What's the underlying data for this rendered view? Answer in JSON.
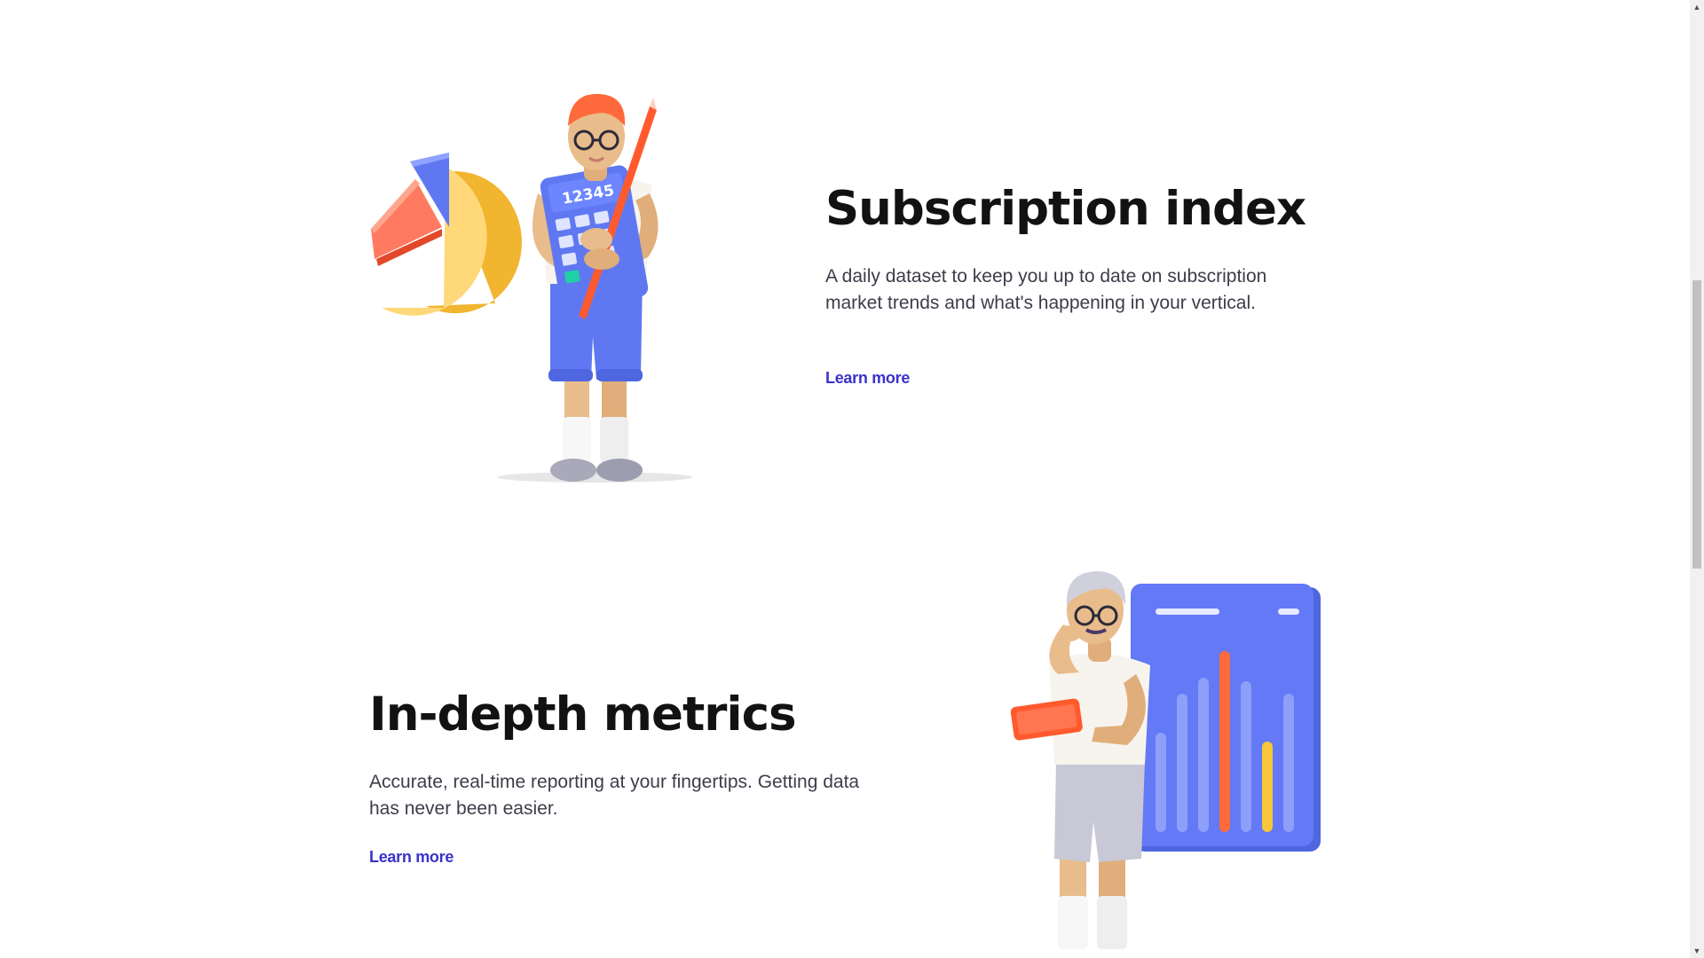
{
  "sections": [
    {
      "title": "Subscription index",
      "description": "A daily dataset to keep you up to date on subscription market trends and what's happening in your vertical.",
      "link_label": "Learn more",
      "illustration": "person-with-calculator-and-pie-chart",
      "calculator_display": "12345"
    },
    {
      "title": "In-depth metrics",
      "description": "Accurate, real-time reporting at your fingertips. Getting data has never been easier.",
      "link_label": "Learn more",
      "illustration": "person-with-tablet-and-bar-chart-board"
    }
  ],
  "scrollbar": {
    "up_icon": "arrow-up-icon",
    "down_icon": "arrow-down-icon"
  },
  "colors": {
    "heading": "#121212",
    "body_text": "#3d3d4a",
    "link": "#3a33c9",
    "illustration_blue": "#5f78f2",
    "illustration_orange": "#ff5a2e",
    "illustration_yellow": "#ffd56a"
  }
}
